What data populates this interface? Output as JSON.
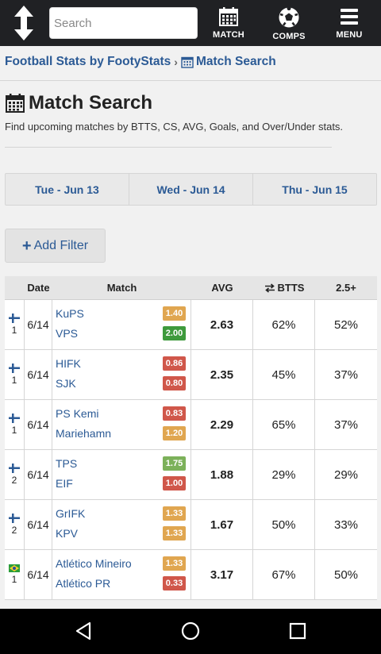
{
  "topbar": {
    "search_placeholder": "Search",
    "nav": [
      {
        "label": "MATCH",
        "icon": "calendar-icon"
      },
      {
        "label": "COMPS",
        "icon": "soccer-ball-icon"
      },
      {
        "label": "MENU",
        "icon": "hamburger-menu-icon"
      }
    ]
  },
  "breadcrumb": {
    "home": "Football Stats by FootyStats",
    "separator": "›",
    "current": "Match Search"
  },
  "page": {
    "title": "Match Search",
    "subtitle": "Find upcoming matches by BTTS, CS, AVG, Goals, and Over/Under stats."
  },
  "days": [
    "Tue - Jun 13",
    "Wed - Jun 14",
    "Thu - Jun 15"
  ],
  "add_filter": "Add Filter",
  "table": {
    "headers": {
      "date": "Date",
      "match": "Match",
      "avg": "AVG",
      "btts": "BTTS",
      "o25": "2.5+"
    },
    "rows": [
      {
        "comp_icon": "finland-flag-icon",
        "division": "1",
        "date": "6/14",
        "home": "KuPS",
        "away": "VPS",
        "home_ppg": "1.40",
        "away_ppg": "2.00",
        "home_color": "#e0a650",
        "away_color": "#3e9a3c",
        "avg": "2.63",
        "btts": "62%",
        "o25": "52%"
      },
      {
        "comp_icon": "finland-flag-icon",
        "division": "1",
        "date": "6/14",
        "home": "HIFK",
        "away": "SJK",
        "home_ppg": "0.86",
        "away_ppg": "0.80",
        "home_color": "#d0574a",
        "away_color": "#d0574a",
        "avg": "2.35",
        "btts": "45%",
        "o25": "37%"
      },
      {
        "comp_icon": "finland-flag-icon",
        "division": "1",
        "date": "6/14",
        "home": "PS Kemi",
        "away": "Mariehamn",
        "home_ppg": "0.83",
        "away_ppg": "1.20",
        "home_color": "#d0574a",
        "away_color": "#e0a650",
        "avg": "2.29",
        "btts": "65%",
        "o25": "37%"
      },
      {
        "comp_icon": "finland-flag-icon",
        "division": "2",
        "date": "6/14",
        "home": "TPS",
        "away": "EIF",
        "home_ppg": "1.75",
        "away_ppg": "1.00",
        "home_color": "#7cb15a",
        "away_color": "#d0574a",
        "avg": "1.88",
        "btts": "29%",
        "o25": "29%"
      },
      {
        "comp_icon": "finland-flag-icon",
        "division": "2",
        "date": "6/14",
        "home": "GrIFK",
        "away": "KPV",
        "home_ppg": "1.33",
        "away_ppg": "1.33",
        "home_color": "#e0a650",
        "away_color": "#e0a650",
        "avg": "1.67",
        "btts": "50%",
        "o25": "33%"
      },
      {
        "comp_icon": "brazil-flag-icon",
        "division": "1",
        "date": "6/14",
        "home": "Atlético Mineiro",
        "away": "Atlético PR",
        "home_ppg": "1.33",
        "away_ppg": "0.33",
        "home_color": "#e0a650",
        "away_color": "#d0574a",
        "avg": "3.17",
        "btts": "67%",
        "o25": "50%"
      }
    ]
  }
}
